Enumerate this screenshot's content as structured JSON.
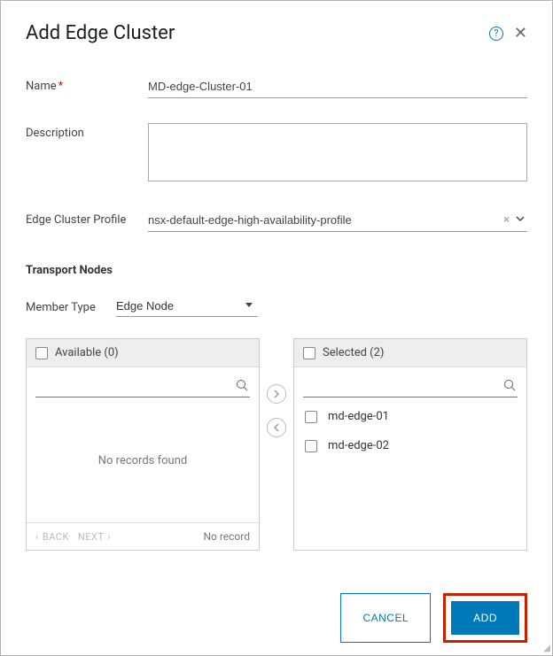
{
  "dialog_title": "Add Edge Cluster",
  "labels": {
    "name": "Name",
    "description": "Description",
    "profile": "Edge Cluster Profile",
    "member_type": "Member Type"
  },
  "fields": {
    "name": "MD-edge-Cluster-01",
    "description": "",
    "profile": "nsx-default-edge-high-availability-profile",
    "member_type": "Edge Node"
  },
  "section_transport_nodes": "Transport Nodes",
  "panels": {
    "available": {
      "heading": "Available (0)",
      "empty_text": "No records found",
      "paging_back": "BACK",
      "paging_next": "NEXT",
      "paging_info": "No record",
      "items": []
    },
    "selected": {
      "heading": "Selected (2)",
      "items": [
        "md-edge-01",
        "md-edge-02"
      ]
    }
  },
  "buttons": {
    "cancel": "CANCEL",
    "add": "ADD"
  }
}
